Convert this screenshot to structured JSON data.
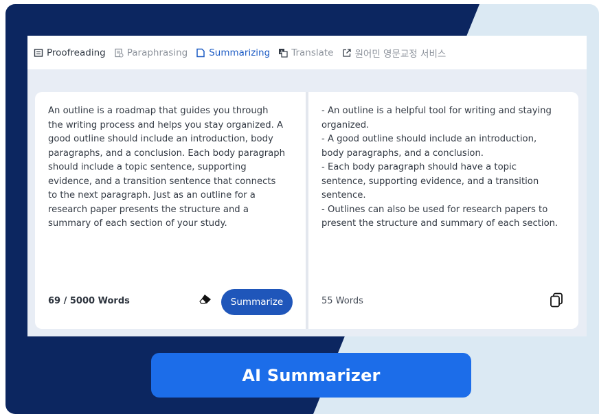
{
  "tabs": [
    {
      "label": "Proofreading",
      "icon": "document-lines-icon",
      "state": "normal-dark"
    },
    {
      "label": "Paraphrasing",
      "icon": "paraphrase-icon",
      "state": "muted"
    },
    {
      "label": "Summarizing",
      "icon": "summary-doc-icon",
      "state": "active"
    },
    {
      "label": "Translate",
      "icon": "translate-icon",
      "state": "muted"
    },
    {
      "label": "원어민 영문교정 서비스",
      "icon": "external-link-icon",
      "state": "muted"
    }
  ],
  "input": {
    "lines": [
      "An outline is a roadmap that guides you through",
      "the writing process and helps you stay organized. A",
      "good outline should include an introduction, body",
      "paragraphs, and a conclusion. Each body paragraph",
      "should include a topic sentence, supporting",
      "evidence, and a transition sentence that connects",
      "to the next paragraph. Just as an outline for a",
      "research paper presents the structure and a",
      "summary of each section of your study."
    ],
    "word_count": "69 / 5000 Words",
    "summarize_label": "Summarize"
  },
  "output": {
    "lines": [
      "- An outline is a helpful tool for writing and staying",
      "organized.",
      "- A good outline should include an introduction,",
      "body paragraphs, and a conclusion.",
      "- Each body paragraph should have a topic",
      "sentence, supporting evidence, and a transition",
      "sentence.",
      "- Outlines can also be used for research papers to",
      "present the structure and summary of each section."
    ],
    "word_count": "55 Words"
  },
  "cta": {
    "label": "AI Summarizer"
  },
  "colors": {
    "navy": "#0c2660",
    "light_bg": "#dbe9f3",
    "active_tab": "#1c5bc4",
    "button": "#1f56ba",
    "cta": "#1c6de9"
  }
}
